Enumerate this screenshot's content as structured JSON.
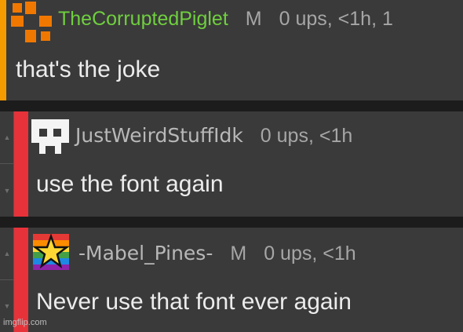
{
  "comments": [
    {
      "username": "TheCorruptedPiglet",
      "mod_badge": "M",
      "meta": "0 ups, <1h, 1",
      "text": "that's the joke",
      "accent_color": "#f59b00",
      "avatar_icon": "orange-cross-avatar-icon"
    },
    {
      "username": "JustWeirdStuffIdk",
      "mod_badge": "",
      "meta": "0 ups, <1h",
      "text": "use the font again",
      "accent_color": "#e8323a",
      "avatar_icon": "pixel-face-avatar-icon",
      "vote_up_icon": "upvote-arrow-icon",
      "vote_down_icon": "downvote-arrow-icon"
    },
    {
      "username": "-Mabel_Pines-",
      "mod_badge": "M",
      "meta": "0 ups, <1h",
      "text": "Never use that font ever again",
      "accent_color": "#e8323a",
      "avatar_icon": "rainbow-star-avatar-icon",
      "vote_up_icon": "upvote-arrow-icon",
      "vote_down_icon": "downvote-arrow-icon"
    }
  ],
  "watermark": "imgflip.com"
}
